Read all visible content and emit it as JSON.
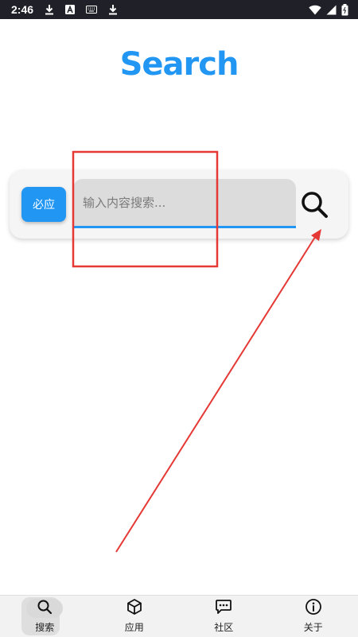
{
  "status_bar": {
    "time": "2:46",
    "left_icons": [
      "download-icon",
      "font-a-icon",
      "keyboard-icon",
      "download-icon"
    ],
    "right_icons": [
      "wifi-icon",
      "signal-icon",
      "battery-icon"
    ]
  },
  "logo": {
    "text": "Search",
    "color": "#2196f3"
  },
  "search": {
    "engine_label": "必应",
    "placeholder": "输入内容搜索...",
    "value": "",
    "submit_icon": "search-icon"
  },
  "bottom_nav": {
    "items": [
      {
        "label": "搜索",
        "icon": "search-icon",
        "active": true
      },
      {
        "label": "应用",
        "icon": "cube-icon",
        "active": false
      },
      {
        "label": "社区",
        "icon": "chat-bubble-icon",
        "active": false
      },
      {
        "label": "关于",
        "icon": "info-icon",
        "active": false
      }
    ]
  },
  "colors": {
    "accent": "#2196f3",
    "status_bar": "#202028",
    "annotation": "#e53935"
  }
}
